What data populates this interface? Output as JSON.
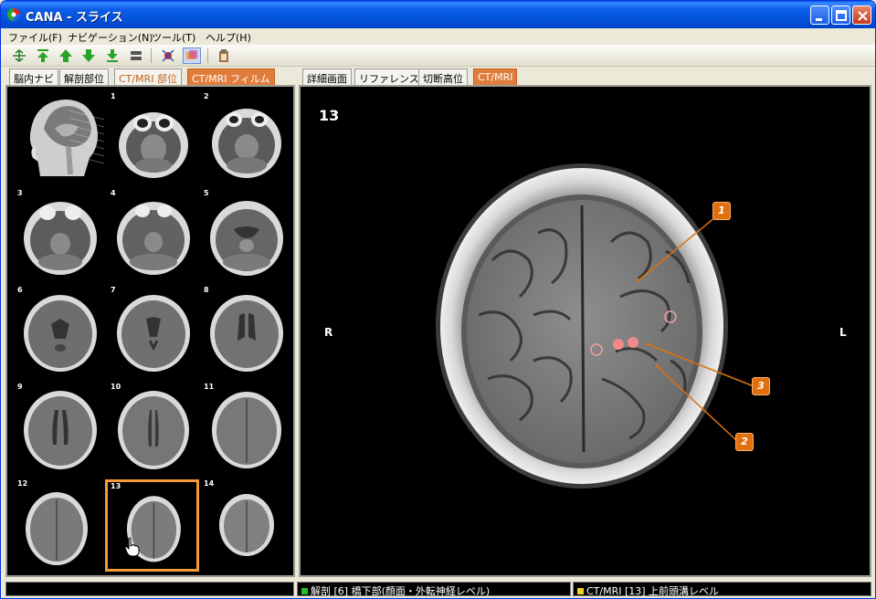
{
  "window": {
    "title": "CANA - スライス"
  },
  "menu": [
    "ファイル(F)",
    "ナビゲーション(N)",
    "ツール(T)",
    "ヘルプ(H)"
  ],
  "toolbar": {
    "buttons": [
      "fit-icon",
      "top-icon",
      "up-icon",
      "down-icon",
      "bottom-icon",
      "layer-icon",
      "marker-icon",
      "slice-view-icon",
      "clipboard-icon"
    ]
  },
  "left_tabs": [
    "脳内ナビ",
    "解剖部位",
    "CT/MRI 部位",
    "CT/MRI フィルム"
  ],
  "right_tabs": [
    "詳細画面",
    "リファレンス",
    "切断高位",
    "CT/MRI"
  ],
  "thumbnails": {
    "labels": [
      "1",
      "2",
      "3",
      "4",
      "5",
      "6",
      "7",
      "8",
      "9",
      "10",
      "11",
      "12",
      "13",
      "14"
    ],
    "selected": "13"
  },
  "viewer": {
    "slice_number": "13",
    "left_label": "R",
    "right_label": "L",
    "markers": [
      "1",
      "2",
      "3"
    ]
  },
  "status": {
    "segment1": "解剖 [6] 橋下部(顔面・外転神経レベル)",
    "segment2": "CT/MRI [13] 上前頭溝レベル"
  },
  "colors": {
    "tab_selected": "#e07d3c",
    "selected_thumb_border": "#f39a3a",
    "marker": "#e0700e",
    "status_green": "#22c322",
    "status_yellow": "#f2d21a"
  }
}
